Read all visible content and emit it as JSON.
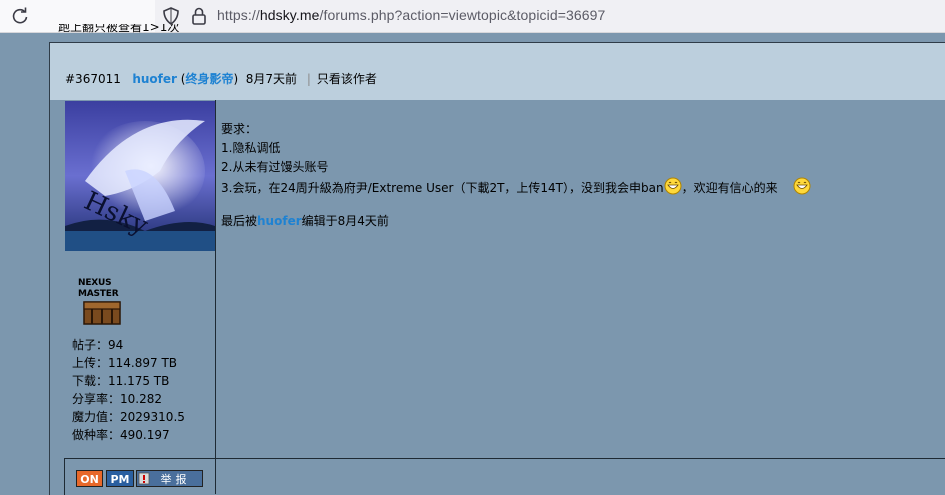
{
  "browser": {
    "url_host_prefix": "https://",
    "url_host": "hdsky.me",
    "url_path": "/forums.php?action=viewtopic&topicid=36697"
  },
  "page": {
    "cut_text": "跑上翻只被查看1>1次"
  },
  "post": {
    "id": "#367011",
    "author": "huofer",
    "rank": "终身影帝",
    "time": "8月7天前",
    "only_author_link": "只看该作者",
    "body_lines": [
      "要求：",
      "1.隐私调低",
      "2.从未有过馒头账号"
    ],
    "line3_before": "3.会玩，在24周升級為府尹/Extreme User（下載2T，上传14T），没到我会申ban",
    "line3_after": "，欢迎有信心的来",
    "edited_prefix": "最后被",
    "edited_by": "huofer",
    "edited_suffix": "编辑于8月4天前"
  },
  "user": {
    "badge_line1": "NEXUS",
    "badge_line2": "MASTER",
    "stats": [
      "帖子：94",
      "上传：114.897 TB",
      "下载：11.175 TB",
      "分享率：10.282",
      "魔力值：2029310.5",
      "做种率：490.197"
    ],
    "avatar_text": "HDsky"
  },
  "buttons": {
    "online": "ON",
    "pm": "PM",
    "report": "举报"
  },
  "colors": {
    "page_bg": "#7c97ae",
    "header_bg": "#bccfdd",
    "link": "#1e82d2"
  }
}
